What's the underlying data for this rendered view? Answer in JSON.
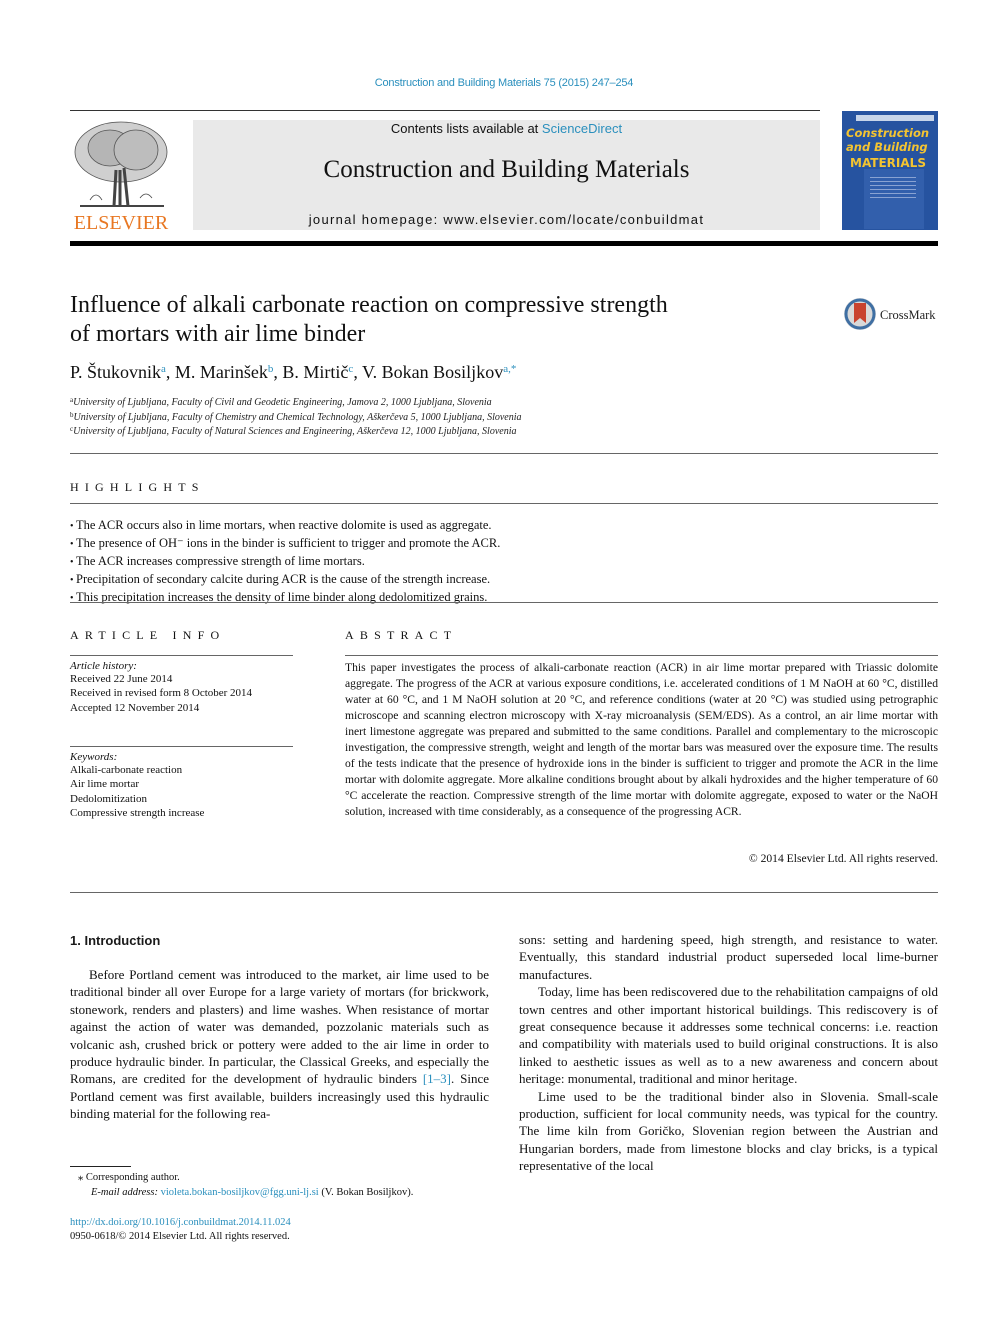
{
  "journal_ref": "Construction and Building Materials 75 (2015) 247–254",
  "header": {
    "contents_prefix": "Contents lists available at ",
    "contents_link": "ScienceDirect",
    "journal_name": "Construction and Building Materials",
    "homepage": "journal homepage: www.elsevier.com/locate/conbuildmat",
    "publisher_logo_text": "ELSEVIER",
    "cover": {
      "line1": "Construction",
      "line2": "and Building",
      "line3": "MATERIALS"
    },
    "colors": {
      "link": "#2a8fbd",
      "elsevier_orange": "#e87722",
      "cover_blue": "#2653a0",
      "cover_yellow": "#f4c431"
    }
  },
  "article": {
    "title_line1": "Influence of alkali carbonate reaction on compressive strength",
    "title_line2": "of mortars with air lime binder",
    "crossmark_label": "CrossMark",
    "authors": [
      {
        "name": "P. Štukovnik",
        "sup": "a"
      },
      {
        "name": "M. Marinšek",
        "sup": "b"
      },
      {
        "name": "B. Mirtič",
        "sup": "c"
      },
      {
        "name": "V. Bokan Bosiljkov",
        "sup": "a,*"
      }
    ],
    "affiliations": [
      {
        "sup": "a",
        "text": "University of Ljubljana, Faculty of Civil and Geodetic Engineering, Jamova 2, 1000 Ljubljana, Slovenia"
      },
      {
        "sup": "b",
        "text": "University of Ljubljana, Faculty of Chemistry and Chemical Technology, Aškerčeva 5, 1000 Ljubljana, Slovenia"
      },
      {
        "sup": "c",
        "text": "University of Ljubljana, Faculty of Natural Sciences and Engineering, Aškerčeva 12, 1000 Ljubljana, Slovenia"
      }
    ]
  },
  "highlights": {
    "heading": "HIGHLIGHTS",
    "items": [
      "The ACR occurs also in lime mortars, when reactive dolomite is used as aggregate.",
      "The presence of OH⁻ ions in the binder is sufficient to trigger and promote the ACR.",
      "The ACR increases compressive strength of lime mortars.",
      "Precipitation of secondary calcite during ACR is the cause of the strength increase.",
      "This precipitation increases the density of lime binder along dedolomitized grains."
    ]
  },
  "article_info": {
    "heading": "ARTICLE INFO",
    "history_label": "Article history:",
    "history": [
      "Received 22 June 2014",
      "Received in revised form 8 October 2014",
      "Accepted 12 November 2014"
    ],
    "keywords_label": "Keywords:",
    "keywords": [
      "Alkali-carbonate reaction",
      "Air lime mortar",
      "Dedolomitization",
      "Compressive strength increase"
    ]
  },
  "abstract": {
    "heading": "ABSTRACT",
    "text": "This paper investigates the process of alkali-carbonate reaction (ACR) in air lime mortar prepared with Triassic dolomite aggregate. The progress of the ACR at various exposure conditions, i.e. accelerated conditions of 1 M NaOH at 60 °C, distilled water at 60 °C, and 1 M NaOH solution at 20 °C, and reference conditions (water at 20 °C) was studied using petrographic microscope and scanning electron microscopy with X-ray microanalysis (SEM/EDS). As a control, an air lime mortar with inert limestone aggregate was prepared and submitted to the same conditions. Parallel and complementary to the microscopic investigation, the compressive strength, weight and length of the mortar bars was measured over the exposure time. The results of the tests indicate that the presence of hydroxide ions in the binder is sufficient to trigger and promote the ACR in the lime mortar with dolomite aggregate. More alkaline conditions brought about by alkali hydroxides and the higher temperature of 60 °C accelerate the reaction. Compressive strength of the lime mortar with dolomite aggregate, exposed to water or the NaOH solution, increased with time considerably, as a consequence of the progressing ACR.",
    "copyright": "© 2014 Elsevier Ltd. All rights reserved."
  },
  "introduction": {
    "heading": "1. Introduction",
    "left_p1_before_ref": "Before Portland cement was introduced to the market, air lime used to be traditional binder all over Europe for a large variety of mortars (for brickwork, stonework, renders and plasters) and lime washes. When resistance of mortar against the action of water was demanded, pozzolanic materials such as volcanic ash, crushed brick or pottery were added to the air lime in order to produce hydraulic binder. In particular, the Classical Greeks, and especially the Romans, are credited for the development of hydraulic binders ",
    "left_p1_ref": "[1–3]",
    "left_p1_after_ref": ". Since Portland cement was first available, builders increasingly used this hydraulic binding material for the following rea-",
    "right_p1": "sons: setting and hardening speed, high strength, and resistance to water. Eventually, this standard industrial product superseded local lime-burner manufactures.",
    "right_p2": "Today, lime has been rediscovered due to the rehabilitation campaigns of old town centres and other important historical buildings. This rediscovery is of great consequence because it addresses some technical concerns: i.e. reaction and compatibility with materials used to build original constructions. It is also linked to aesthetic issues as well as to a new awareness and concern about heritage: monumental, traditional and minor heritage.",
    "right_p3": "Lime used to be the traditional binder also in Slovenia. Small-scale production, sufficient for local community needs, was typical for the country. The lime kiln from Goričko, Slovenian region between the Austrian and Hungarian borders, made from limestone blocks and clay bricks, is a typical representative of the local"
  },
  "footnotes": {
    "corresponding": "Corresponding author.",
    "email_label": "E-mail address:",
    "email": "violeta.bokan-bosiljkov@fgg.uni-lj.si",
    "email_suffix": " (V. Bokan Bosiljkov).",
    "doi": "http://dx.doi.org/10.1016/j.conbuildmat.2014.11.024",
    "issn_line": "0950-0618/© 2014 Elsevier Ltd. All rights reserved."
  }
}
